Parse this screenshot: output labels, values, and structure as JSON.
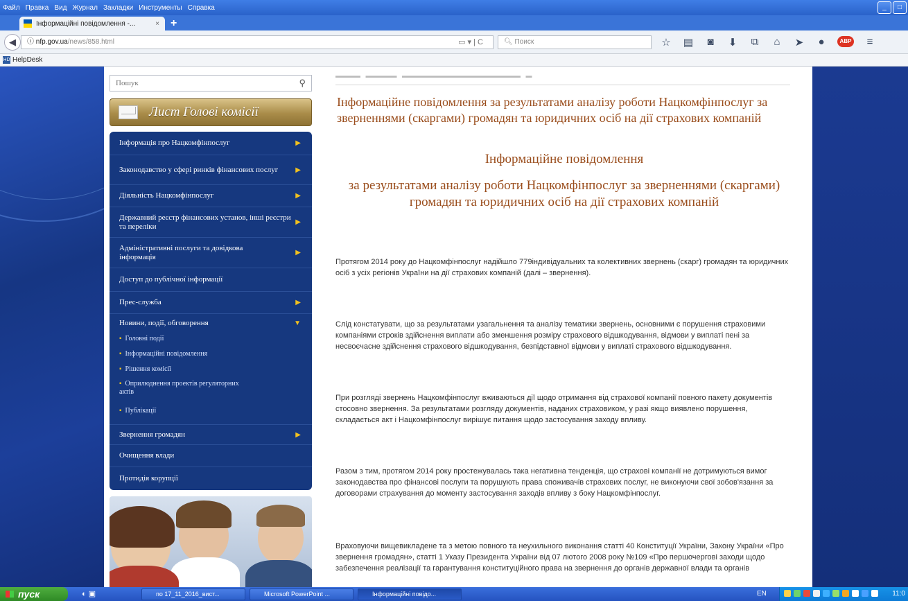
{
  "browser": {
    "menu": [
      "Файл",
      "Правка",
      "Вид",
      "Журнал",
      "Закладки",
      "Инструменты",
      "Справка"
    ],
    "tab_title": "Інформаційні повідомлення -...",
    "url_host": "nfp.gov.ua",
    "url_path": "/news/858.html",
    "search_placeholder": "Поиск",
    "bookmark": "HelpDesk"
  },
  "sidebar": {
    "search_placeholder": "Пошук",
    "letter_button": "Лист Голові комісії",
    "nav": [
      {
        "label": "Інформація про Нацкомфінпослуг",
        "arrow": "▶"
      },
      {
        "label": "Законодавство у сфері ринків фінансових послуг",
        "arrow": "▶"
      },
      {
        "label": "Діяльність Нацкомфінпослуг",
        "arrow": "▶"
      },
      {
        "label": "Державний реєстр фінансових установ, інші реєстри та переліки",
        "arrow": "▶"
      },
      {
        "label": "Адміністративні послуги та довідкова інформація",
        "arrow": "▶"
      },
      {
        "label": "Доступ до публічної інформації",
        "arrow": ""
      },
      {
        "label": "Прес-служба",
        "arrow": "▶"
      },
      {
        "label": "Новини, події, обговорення",
        "arrow": "▼"
      },
      {
        "label": "Звернення громадян",
        "arrow": "▶"
      },
      {
        "label": "Очищення влади",
        "arrow": ""
      },
      {
        "label": "Протидія корупції",
        "arrow": ""
      }
    ],
    "subnav": [
      "Головні події",
      "Інформаційні повідомлення",
      "Рішення комісії",
      "Оприлюднення проектів регуляторних актів",
      "Публікації"
    ]
  },
  "content": {
    "title": "Інформаційне повідомлення за результатами аналізу роботи Нацкомфінпослуг за зверненнями (скаргами) громадян та юридичних осіб на дії страхових компаній",
    "subtitle": "Інформаційне повідомлення",
    "subtitle2": "за результатами аналізу роботи Нацкомфінпослуг за зверненнями (скаргами) громадян та юридичних осіб на дії страхових компаній",
    "paragraphs": [
      "Протягом 2014 року до Нацкомфінпослуг надійшло 779індивідуальних та колективних звернень (скарг) громадян та юридичних осіб з усіх регіонів України на дії страхових компаній (далі – звернення).",
      "Слід констатувати, що за результатами узагальнення та аналізу тематики звернень, основними є порушення страховими компаніями строків здійснення виплати або зменшення розміру страхового відшкодування, відмови у виплаті пені за несвоєчасне здійснення страхового відшкодування, безпідставної відмови у виплаті страхового відшкодування.",
      "При розгляді звернень Нацкомфінпослуг вживаються дії щодо отримання від страхової компанії повного пакету документів стосовно звернення. За результатами розгляду документів, наданих страховиком, у разі якщо виявлено порушення, складається акт і Нацкомфінпослуг вирішує питання щодо застосування заходу впливу.",
      "Разом з тим, протягом 2014 року простежувалась така негативна тенденція, що страхові компанії не дотримуються вимог законодавства про фінансові послуги та порушують права споживачів страхових послуг, не виконуючи свої зобов'язання за договорами страхування до моменту застосування заходів впливу з боку Нацкомфінпослуг.",
      "Враховуючи вищевикладене та з метою повного та неухильного виконання статті 40 Конституції України, Закону України «Про звернення громадян», статті 1 Указу Президента України від 07 лютого 2008 року №109 «Про першочергові заходи щодо забезпечення реалізації та гарантування конституційного права на звернення до органів державної влади та органів"
    ]
  },
  "taskbar": {
    "start": "пуск",
    "tasks": [
      "по 17_11_2016_вист...",
      "Microsoft PowerPoint ...",
      "Інформаційні повідо..."
    ],
    "lang": "EN",
    "clock": "11:0"
  },
  "colors": {
    "nav_bg": "#16387f",
    "title_color": "#9a4d1c",
    "arrow_color": "#f0c020"
  }
}
